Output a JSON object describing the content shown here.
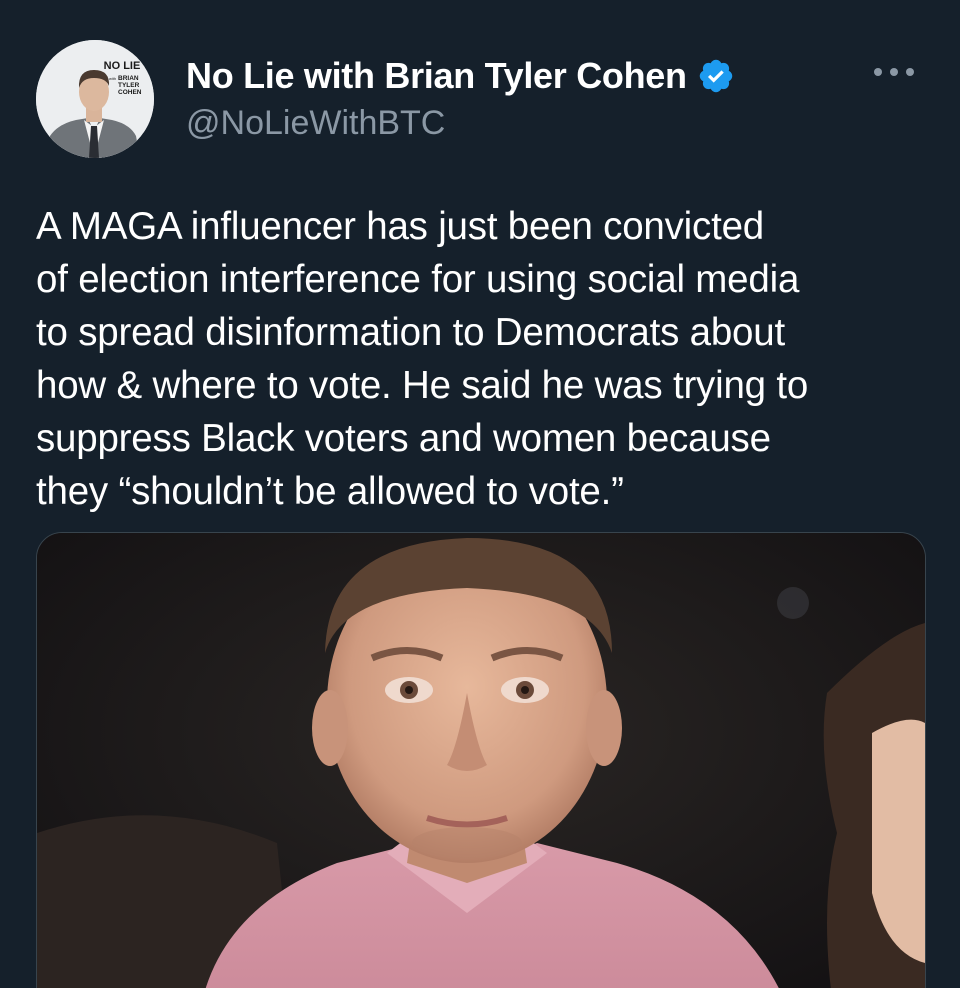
{
  "author": {
    "display_name": "No Lie with Brian Tyler Cohen",
    "handle": "@NoLieWithBTC",
    "verified": true,
    "verified_icon": "verified-badge-icon",
    "avatar_logo_text": [
      "NO LIE",
      "with",
      "BRIAN",
      "TYLER",
      "COHEN"
    ]
  },
  "menu": {
    "more_icon": "more-horizontal-icon"
  },
  "tweet": {
    "text": "A MAGA influencer has just been convicted\nof election interference for using social media\nto spread disinformation to Democrats about\nhow & where to vote. He said he was trying to\nsuppress Black voters and women because\nthey “shouldn’t be allowed to vote.”"
  },
  "colors": {
    "background": "#15202b",
    "text": "#ffffff",
    "secondary_text": "#8b98a5",
    "verified_blue": "#1d9bf0",
    "border": "#38444d"
  }
}
